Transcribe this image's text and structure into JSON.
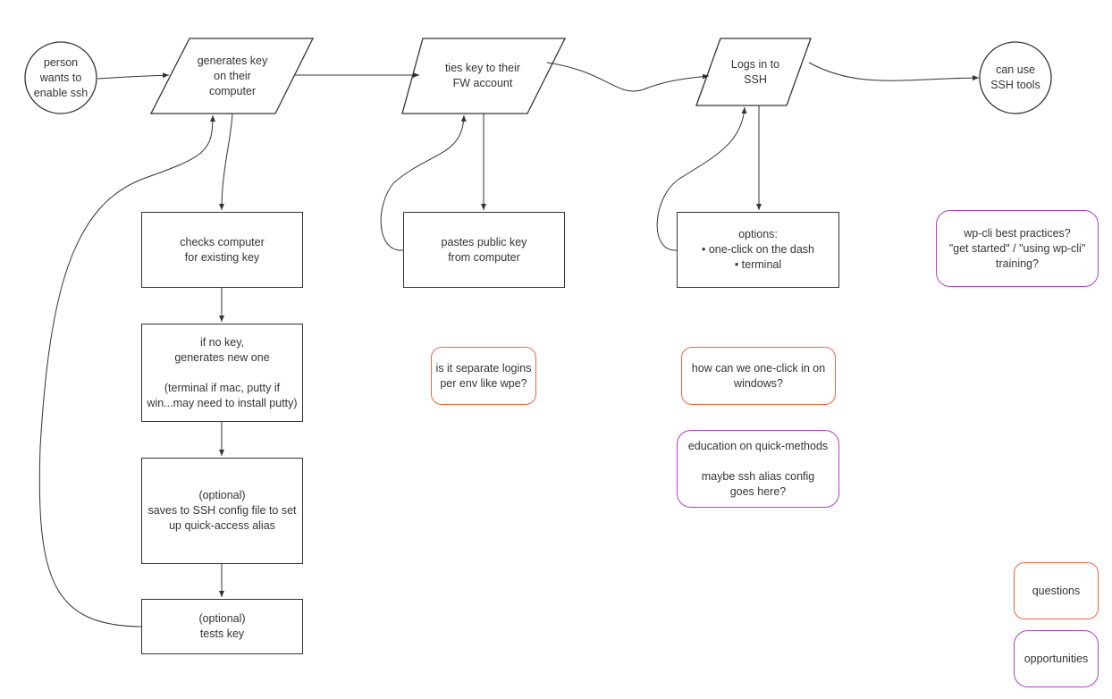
{
  "colors": {
    "line": "#333333",
    "questions": "#f0643c",
    "opportunities": "#b040c8"
  },
  "flow": {
    "start": "person\nwants to\nenable ssh",
    "generate": "generates key\non their\ncomputer",
    "tie": "ties key to their\nFW account",
    "login": "Logs in to\nSSH",
    "end": "can use\nSSH tools"
  },
  "steps": {
    "check": "checks computer\nfor existing key",
    "nokey": "if no key,\ngenerates new one\n\n(terminal if mac, putty if\nwin...may need to install putty)",
    "save": "(optional)\nsaves to SSH config file to set\nup quick-access alias",
    "test": "(optional)\ntests key",
    "paste": "pastes public key\nfrom computer",
    "options": "options:\n• one-click on the dash\n• terminal"
  },
  "notes": {
    "q_logins": "is it separate logins\nper env like wpe?",
    "q_windows": "how can we one-click in on\nwindows?",
    "o_education": "education on quick-methods\n\nmaybe ssh alias config\ngoes here?",
    "o_wpcli": "wp-cli best practices?\n\"get started\" / \"using wp-cli\"\ntraining?"
  },
  "legend": {
    "questions": "questions",
    "opportunities": "opportunities"
  }
}
